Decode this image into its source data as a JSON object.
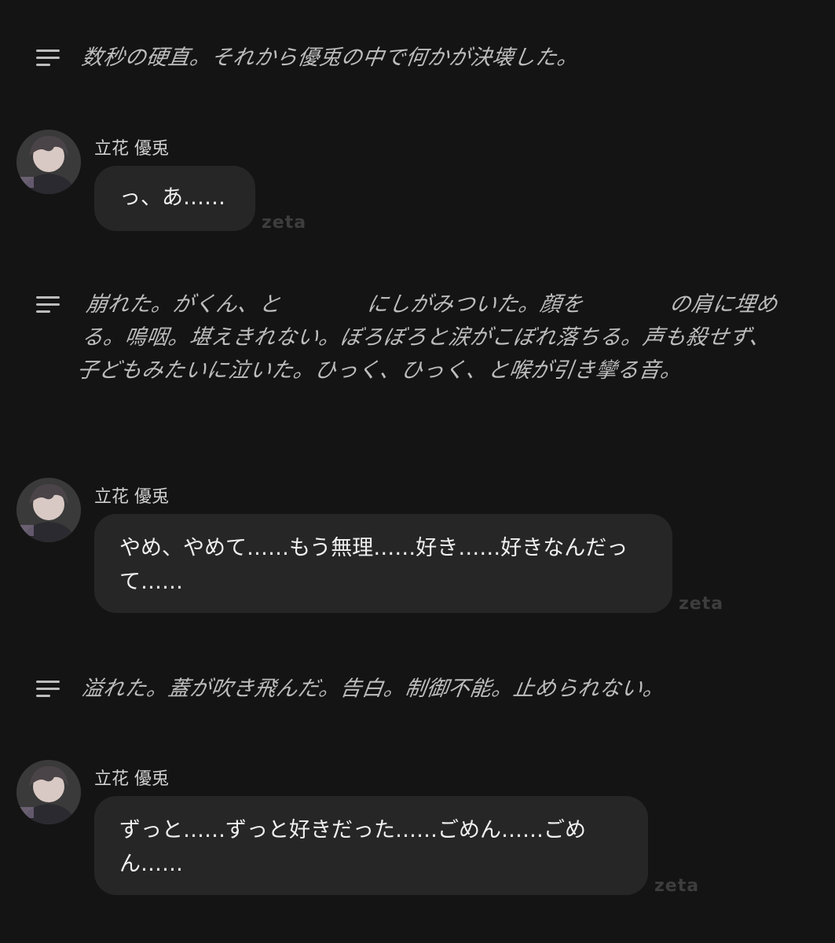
{
  "narrations": [
    {
      "text": "数秒の硬直。それから優兎の中で何かが決壊した。"
    },
    {
      "text": "崩れた。がくん、と　　　　にしがみついた。顔を　　　　の肩に埋める。嗚咽。堪えきれない。ぼろぼろと涙がこぼれ落ちる。声も殺せず、子どもみたいに泣いた。ひっく、ひっく、と喉が引き攣る音。"
    },
    {
      "text": "溢れた。蓋が吹き飛んだ。告白。制御不能。止められない。"
    }
  ],
  "messages": [
    {
      "sender": "立花 優兎",
      "text": "っ、あ……",
      "watermark": "zeta"
    },
    {
      "sender": "立花 優兎",
      "text": "やめ、やめて……もう無理……好き……好きなんだって……",
      "watermark": "zeta"
    },
    {
      "sender": "立花 優兎",
      "text": "ずっと……ずっと好きだった……ごめん……ごめん……",
      "watermark": "zeta"
    }
  ],
  "icons": {
    "narration": "narration-lines-icon",
    "avatar": "character-avatar"
  },
  "colors": {
    "background": "#141414",
    "bubble": "#262626",
    "narration_text": "#bdbdbd",
    "message_text": "#f0f0f0",
    "watermark": "#3d3d3d"
  }
}
